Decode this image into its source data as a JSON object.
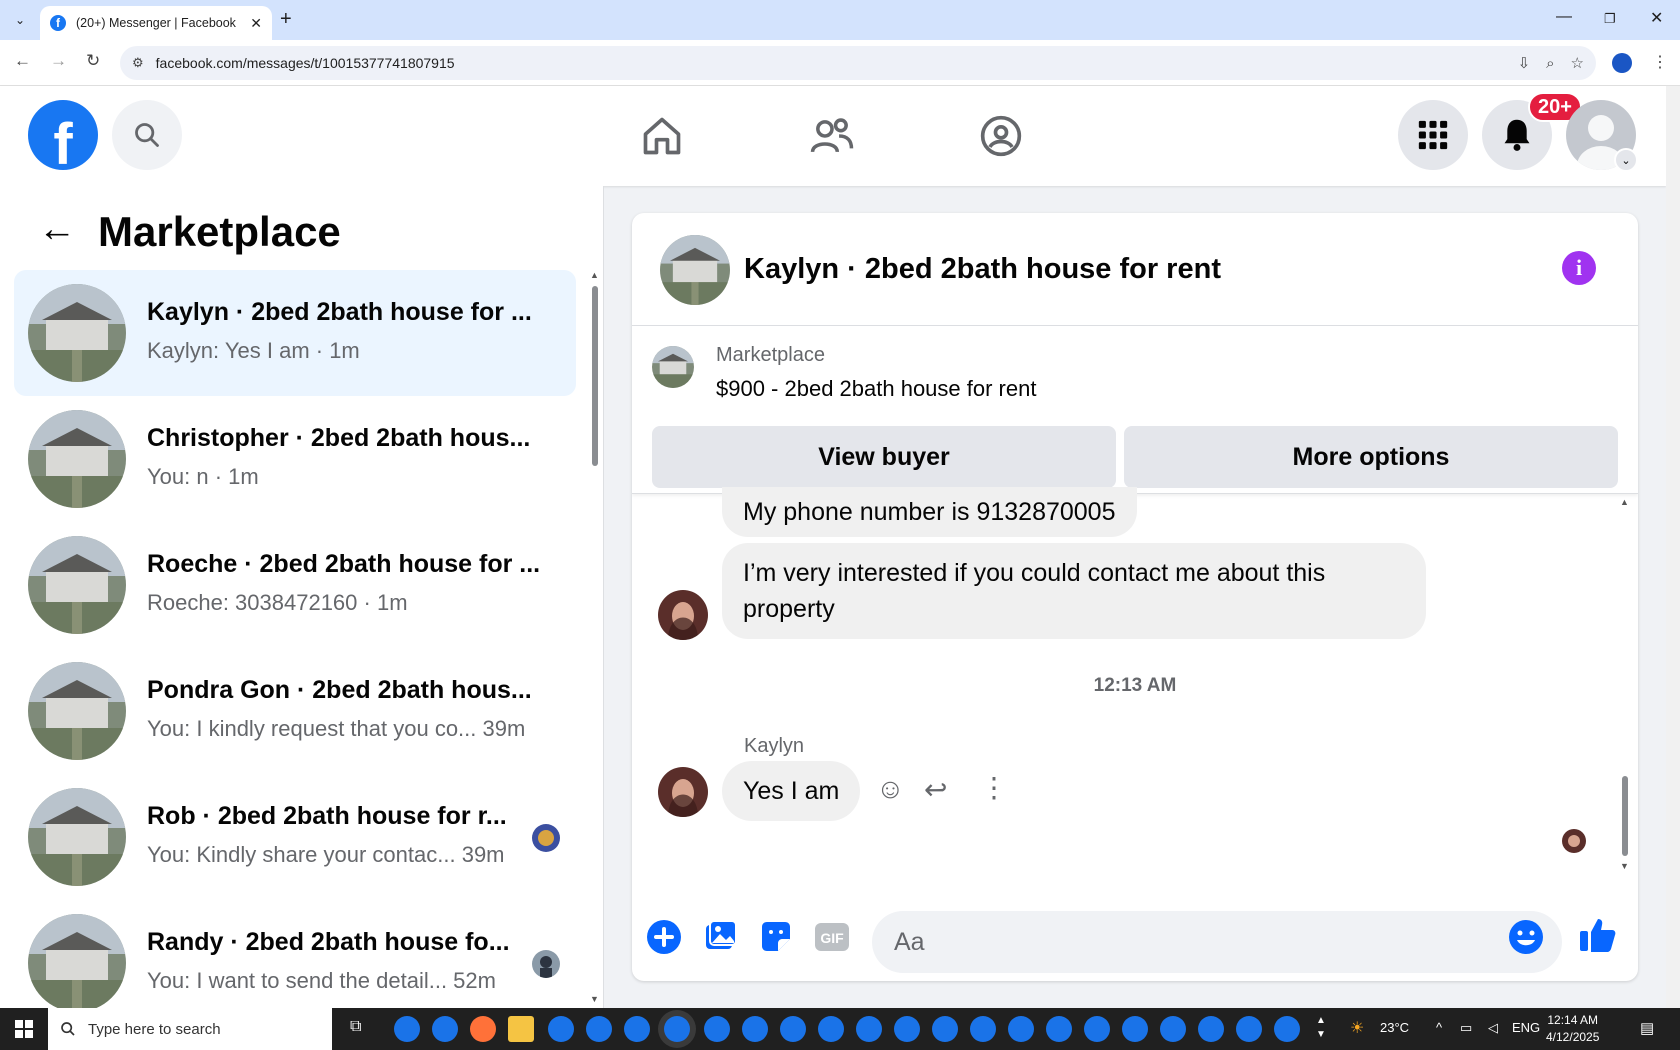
{
  "browser": {
    "tab_title": "(20+) Messenger | Facebook",
    "url": "facebook.com/messages/t/100153777418079 15"
  },
  "fb": {
    "notification_badge": "20+"
  },
  "left": {
    "title": "Marketplace",
    "conversations": [
      {
        "name": "Kaylyn · 2bed 2bath house for ...",
        "snippet": "Kaylyn: Yes I am · 1m",
        "active": true
      },
      {
        "name": "Christopher · 2bed 2bath hous...",
        "snippet": "You: n · 1m"
      },
      {
        "name": "Roeche · 2bed 2bath house for ...",
        "snippet": "Roeche: 3038472160 · 1m"
      },
      {
        "name": "Pondra Gon · 2bed 2bath hous...",
        "snippet": "You: I kindly request that you co...  39m"
      },
      {
        "name": "Rob · 2bed 2bath house for r...",
        "snippet": "You: Kindly share your contac...  39m"
      },
      {
        "name": "Randy · 2bed 2bath house fo...",
        "snippet": "You: I want to send the detail...  52m"
      }
    ]
  },
  "chat": {
    "title": "Kaylyn · 2bed 2bath house for rent",
    "marketplace_label": "Marketplace",
    "listing": "$900 - 2bed 2bath house for rent",
    "view_buyer": "View buyer",
    "more_options": "More options",
    "messages": [
      "My phone number is 9132870005",
      "I’m very interested if you could contact me about this property"
    ],
    "timestamp": "12:13 AM",
    "sender": "Kaylyn",
    "last_message": "Yes I am",
    "composer_placeholder": "Aa"
  },
  "taskbar": {
    "search_placeholder": "Type here to search",
    "temperature": "23°C",
    "language": "ENG",
    "time": "12:14 AM",
    "date": "4/12/2025"
  }
}
